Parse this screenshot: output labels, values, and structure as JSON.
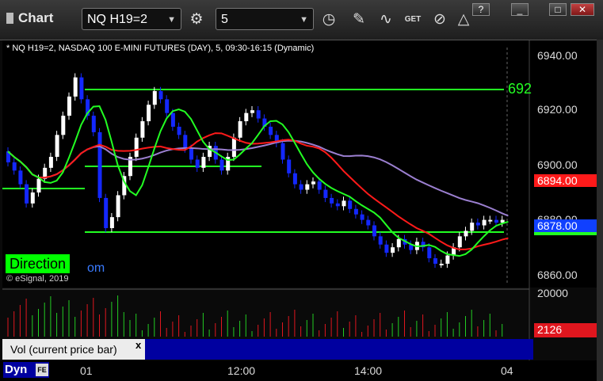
{
  "window": {
    "title": "Chart",
    "symbol_value": "NQ H19=2",
    "interval_value": "5",
    "buttons": {
      "help": "?",
      "minimize": "_",
      "maximize": "□",
      "close": "✕"
    }
  },
  "toolbar": {
    "get_label": "GET"
  },
  "chart": {
    "symbol_label": "* NQ H19=2, NASDAQ 100 E-MINI FUTURES (DAY), 5, 09:30-16:15 (Dynamic)",
    "y_ticks": [
      "6940.00",
      "6920.00",
      "6900.00",
      "6880.00",
      "6860.00"
    ],
    "price_boxes": {
      "red": "6894.00",
      "blue": "6878.00"
    },
    "level_label": "692",
    "direction_label": "Direction",
    "direction_suffix": "om",
    "copyright": "© eSignal, 2019",
    "colors": {
      "up": "#ffffff",
      "down": "#1428ff",
      "green": "#22ff22",
      "red": "#ff1a1a",
      "purple": "#9b7fd0",
      "blue_box": "#1040ff"
    }
  },
  "volume": {
    "label": "Vol (current price bar)",
    "close_glyph": "x",
    "y_tick": "20000",
    "current_box": "2126"
  },
  "x_axis": {
    "dyn_label": "Dyn",
    "fe_label": "FE",
    "ticks": [
      "01",
      "12:00",
      "14:00",
      "04"
    ]
  }
}
